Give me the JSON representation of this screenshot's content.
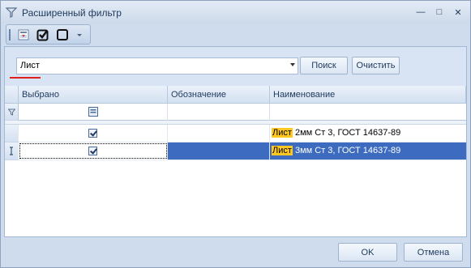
{
  "window": {
    "title": "Расширенный фильтр",
    "title_icon": "funnel-icon",
    "minimize_label": "—",
    "restore_label": "□",
    "close_label": "✕"
  },
  "toolbar": {
    "buttons": [
      {
        "icon": "filter-grid-icon"
      },
      {
        "icon": "checkbox-checked-icon"
      },
      {
        "icon": "checkbox-empty-icon"
      },
      {
        "icon": "dropdown-arrow-icon"
      }
    ]
  },
  "search": {
    "value": "Лист",
    "search_button": "Поиск",
    "clear_button": "Очистить"
  },
  "grid": {
    "columns": [
      "Выбрано",
      "Обозначение",
      "Наименование"
    ],
    "rows": [
      {
        "selected": true,
        "designation": "",
        "name_match": "Лист",
        "name_rest": " 2мм Ст 3, ГОСТ 14637-89"
      },
      {
        "selected": true,
        "designation": "",
        "name_match": "Лист",
        "name_rest": " 3мм Ст 3, ГОСТ 14637-89"
      }
    ]
  },
  "footer": {
    "ok": "OK",
    "cancel": "Отмена"
  },
  "colors": {
    "selection": "#3d6bbf",
    "highlight": "#ffc820",
    "accent_mark": "#e0201c"
  }
}
